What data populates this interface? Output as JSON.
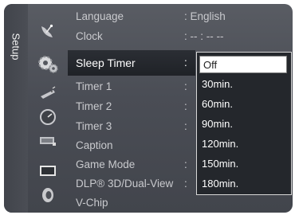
{
  "tab": {
    "label": "Setup"
  },
  "menu": {
    "items": [
      {
        "label": "Language",
        "value": ": English"
      },
      {
        "label": "Clock",
        "value": ": -- : -- --"
      },
      {
        "label": "Sleep Timer",
        "value": ":"
      },
      {
        "label": "Timer 1",
        "value": ":"
      },
      {
        "label": "Timer 2",
        "value": ":"
      },
      {
        "label": "Timer 3",
        "value": ":"
      },
      {
        "label": "Caption",
        "value": ""
      },
      {
        "label": "Game Mode",
        "value": ":"
      },
      {
        "label": "DLP® 3D/Dual-View",
        "value": ":"
      },
      {
        "label": "V-Chip",
        "value": ""
      }
    ]
  },
  "dropdown": {
    "options": [
      "Off",
      "30min.",
      "60min.",
      "90min.",
      "120min.",
      "150min.",
      "180min."
    ],
    "selected": "Off"
  },
  "icons": [
    "satellite-dish-icon",
    "gear-icon",
    "remote-icon",
    "gauge-icon",
    "keyboard-icon",
    "picture-icon",
    "speaker-icon"
  ],
  "colors": {
    "panel": "#4a4d55",
    "highlight": "#1f2227",
    "dropdown_bg": "#24272c",
    "selected_option_bg": "#ffffff"
  }
}
